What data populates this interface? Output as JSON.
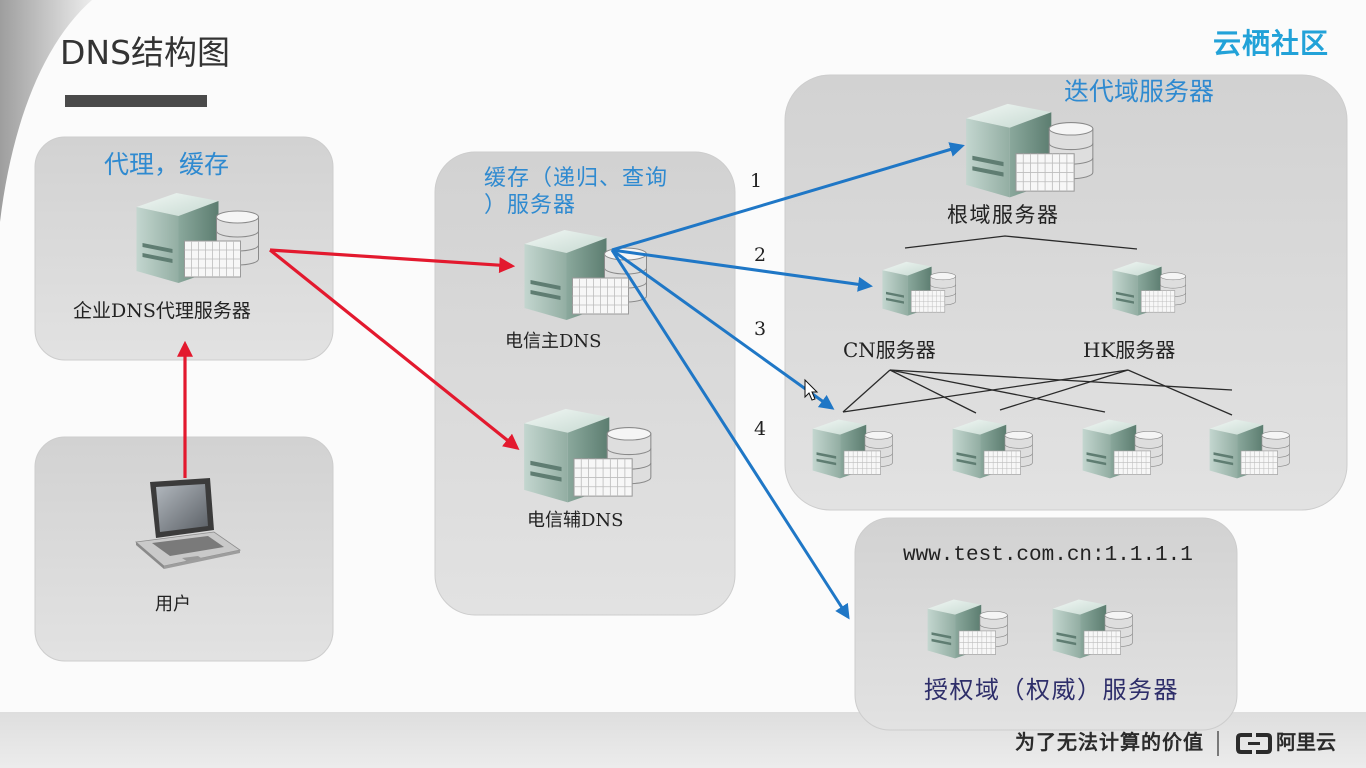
{
  "slide": {
    "title": "DNS结构图",
    "logo_text": "云栖社区"
  },
  "proxy_box": {
    "label": "代理，缓存",
    "server_label": "企业DNS代理服务器"
  },
  "user_box": {
    "label": "用户"
  },
  "recursive_box": {
    "label_line1": "缓存（递归、查询",
    "label_line2": "）服务器",
    "primary_label": "电信主DNS",
    "secondary_label": "电信辅DNS"
  },
  "iterative_box": {
    "label": "迭代域服务器",
    "root_label": "根域服务器",
    "cn_label": "CN服务器",
    "hk_label": "HK服务器"
  },
  "query_steps": [
    "1",
    "2",
    "3",
    "4"
  ],
  "authoritative_box": {
    "record": "www.test.com.cn:1.1.1.1",
    "label": "授权域（权威）服务器"
  },
  "footer": {
    "slogan": "为了无法计算的价值",
    "brand": "阿里云"
  },
  "colors": {
    "label_blue": "#2f8ad0",
    "request_arrow": "#e3192e",
    "query_arrow": "#1f77c6",
    "logo_teal": "#22a2d8",
    "auth_label": "#2e2e6a"
  },
  "icons": [
    "server-icon",
    "laptop-icon",
    "aliyun-logo-icon",
    "mouse-cursor-icon"
  ]
}
